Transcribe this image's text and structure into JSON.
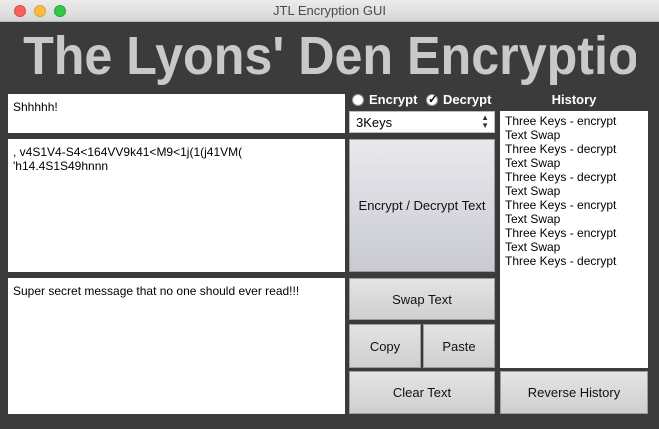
{
  "window": {
    "title": "JTL Encryption GUI"
  },
  "banner": {
    "text": "The Lyons' Den Encryption"
  },
  "text_boxes": {
    "top": "Shhhhh!",
    "middle": ", v4S1V4-S4<164VV9k41<M9<1j(1(j41VM(\n'h14.4S1S49hnnn",
    "bottom": "Super secret message that no one should ever read!!!"
  },
  "mode": {
    "options": [
      {
        "label": "Encrypt",
        "selected": false
      },
      {
        "label": "Decrypt",
        "selected": true
      }
    ]
  },
  "cipher_select": {
    "value": "3Keys"
  },
  "buttons": {
    "encrypt_decrypt": "Encrypt / Decrypt Text",
    "swap": "Swap Text",
    "copy": "Copy",
    "paste": "Paste",
    "clear": "Clear Text",
    "reverse_history": "Reverse History"
  },
  "history": {
    "label": "History",
    "items": [
      "Three Keys - encrypt",
      "Text Swap",
      "Three Keys - decrypt",
      "Text Swap",
      "Three Keys - decrypt",
      "Text Swap",
      "Three Keys - encrypt",
      "Text Swap",
      "Three Keys - encrypt",
      "Text Swap",
      "Three Keys - decrypt"
    ]
  }
}
